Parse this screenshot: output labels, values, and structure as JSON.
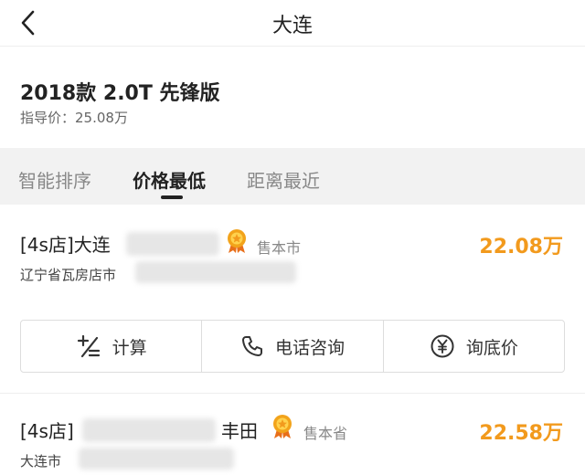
{
  "header": {
    "title": "大连",
    "back_icon": "back-chevron-icon"
  },
  "model": {
    "name": "2018款 2.0T 先锋版",
    "guide_price": "指导价：25.08万"
  },
  "tabs": [
    {
      "label": "智能排序",
      "active": false
    },
    {
      "label": "价格最低",
      "active": true
    },
    {
      "label": "距离最近",
      "active": false
    }
  ],
  "dealers": [
    {
      "name_prefix": "[4s店]大连",
      "name_suffix": "",
      "badge": "medal-icon",
      "sell_area": "售本市",
      "price": "22.08万",
      "address": "辽宁省瓦房店市"
    },
    {
      "name_prefix": "[4s店]",
      "name_suffix": "丰田",
      "badge": "medal-icon",
      "sell_area": "售本省",
      "price": "22.58万",
      "address": "大连市"
    }
  ],
  "actions": [
    {
      "label": "计算",
      "icon": "calculator-icon"
    },
    {
      "label": "电话咨询",
      "icon": "phone-icon"
    },
    {
      "label": "询底价",
      "icon": "yuan-icon"
    }
  ],
  "colors": {
    "accent": "#f29a1d",
    "tab_bg": "#f2f2f2",
    "medal": "#f2a31b"
  }
}
